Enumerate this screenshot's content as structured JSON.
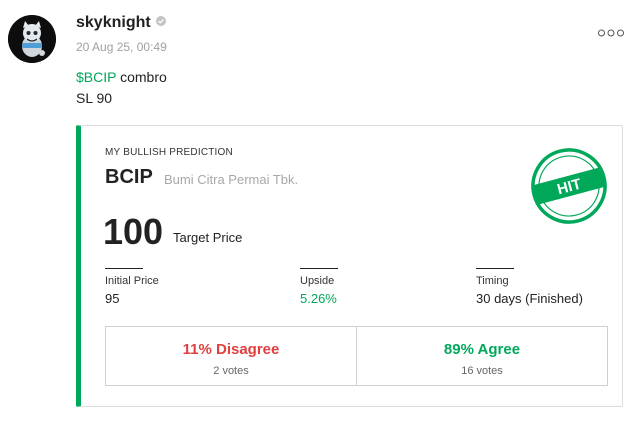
{
  "post": {
    "username": "skyknight",
    "timestamp": "20 Aug 25, 00:49",
    "cashtag": "$BCIP",
    "line1_rest": " combro",
    "line2": "SL 90"
  },
  "prediction": {
    "label": "MY BULLISH PREDICTION",
    "ticker": "BCIP",
    "company": "Bumi Citra Permai Tbk.",
    "stamp_text": "HIT",
    "target_value": "100",
    "target_label": "Target Price",
    "metrics": [
      {
        "label": "Initial Price",
        "value": "95"
      },
      {
        "label": "Upside",
        "value": "5.26%"
      },
      {
        "label": "Timing",
        "value": "30 days (Finished)"
      }
    ],
    "votes": {
      "disagree": {
        "pct": "11% Disagree",
        "count": "2 votes"
      },
      "agree": {
        "pct": "89% Agree",
        "count": "16 votes"
      }
    }
  },
  "colors": {
    "accent_green": "#00a85a",
    "disagree_red": "#e04040",
    "muted": "#a0a0a0"
  },
  "icons": [
    "avatar-image",
    "verified-icon",
    "more-options-icon",
    "hit-stamp-icon"
  ]
}
